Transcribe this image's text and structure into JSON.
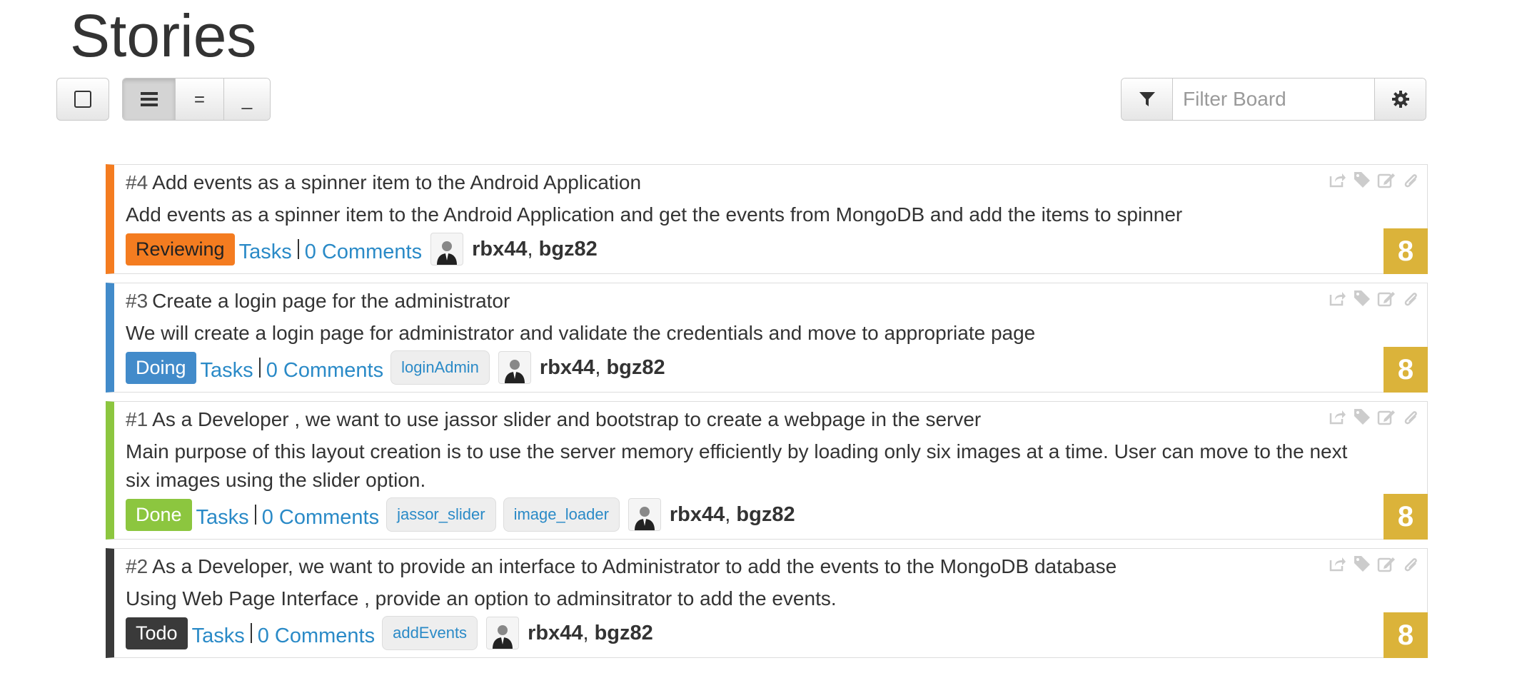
{
  "page": {
    "title": "Stories"
  },
  "toolbar": {
    "view_compact": "=",
    "view_minimal": "_",
    "filter_placeholder": "Filter Board"
  },
  "labels": {
    "tasks": "Tasks"
  },
  "stories": [
    {
      "number": "#4",
      "title": "Add events as a spinner item to the Android Application",
      "description": "Add events as a spinner item to the Android Application and get the events from MongoDB and add the items to spinner",
      "status": "Reviewing",
      "status_color": "#f47c20",
      "comments": "0 Comments",
      "tags": [],
      "assignee1": "rbx44",
      "assignee2": "bgz82",
      "points": "8"
    },
    {
      "number": "#3",
      "title": "Create a login page for the administrator",
      "description": "We will create a login page for administrator and validate the credentials and move to appropriate page",
      "status": "Doing",
      "status_color": "#428bca",
      "comments": "0 Comments",
      "tags": [
        "loginAdmin"
      ],
      "assignee1": "rbx44",
      "assignee2": "bgz82",
      "points": "8"
    },
    {
      "number": "#1",
      "title": "As a Developer , we want to use jassor slider and bootstrap to create a webpage in the server",
      "description": "Main purpose of this layout creation is to use the server memory efficiently by loading only six images at a time. User can move to the next six images using the slider option.",
      "status": "Done",
      "status_color": "#8cc63f",
      "comments": "0 Comments",
      "tags": [
        "jassor_slider",
        "image_loader"
      ],
      "assignee1": "rbx44",
      "assignee2": "bgz82",
      "points": "8"
    },
    {
      "number": "#2",
      "title": "As a Developer, we want to provide an interface to Administrator to add the events to the MongoDB database",
      "description": "Using Web Page Interface , provide an option to adminsitrator to add the events.",
      "status": "Todo",
      "status_color": "#3a3a3a",
      "comments": "0 Comments",
      "tags": [
        "addEvents"
      ],
      "assignee1": "rbx44",
      "assignee2": "bgz82",
      "points": "8"
    }
  ],
  "colors": {
    "points_bg": "#dbb33a",
    "link": "#2a8ac7"
  }
}
